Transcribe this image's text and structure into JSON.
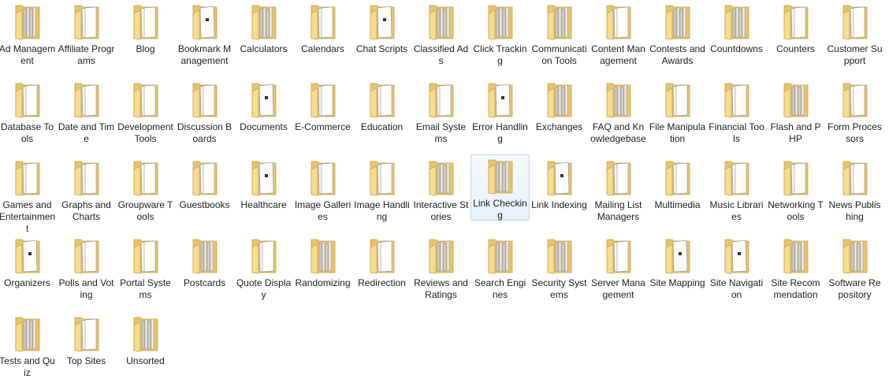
{
  "window": {
    "title": ""
  },
  "folders": [
    {
      "label": "Ad Management",
      "icon": "folder-files-icon",
      "selected": false
    },
    {
      "label": "Affiliate Programs",
      "icon": "folder-papers-icon",
      "selected": false
    },
    {
      "label": "Blog",
      "icon": "folder-papers-icon",
      "selected": false
    },
    {
      "label": "Bookmark Management",
      "icon": "folder-document-icon",
      "selected": false
    },
    {
      "label": "Calculators",
      "icon": "folder-files-icon",
      "selected": false
    },
    {
      "label": "Calendars",
      "icon": "folder-papers-icon",
      "selected": false
    },
    {
      "label": "Chat Scripts",
      "icon": "folder-document-icon",
      "selected": false
    },
    {
      "label": "Classified Ads",
      "icon": "folder-files-icon",
      "selected": false
    },
    {
      "label": "Click Tracking",
      "icon": "folder-files-icon",
      "selected": false
    },
    {
      "label": "Communication Tools",
      "icon": "folder-files-icon",
      "selected": false
    },
    {
      "label": "Content Management",
      "icon": "folder-papers-icon",
      "selected": false
    },
    {
      "label": "Contests and Awards",
      "icon": "folder-files-icon",
      "selected": false
    },
    {
      "label": "Countdowns",
      "icon": "folder-files-icon",
      "selected": false
    },
    {
      "label": "Counters",
      "icon": "folder-papers-icon",
      "selected": false
    },
    {
      "label": "Customer Support",
      "icon": "folder-papers-icon",
      "selected": false
    },
    {
      "label": "Database Tools",
      "icon": "folder-papers-icon",
      "selected": false
    },
    {
      "label": "Date and Time",
      "icon": "folder-papers-icon",
      "selected": false
    },
    {
      "label": "Development Tools",
      "icon": "folder-papers-icon",
      "selected": false
    },
    {
      "label": "Discussion Boards",
      "icon": "folder-papers-icon",
      "selected": false
    },
    {
      "label": "Documents",
      "icon": "folder-document-icon",
      "selected": false
    },
    {
      "label": "E-Commerce",
      "icon": "folder-papers-icon",
      "selected": false
    },
    {
      "label": "Education",
      "icon": "folder-papers-icon",
      "selected": false
    },
    {
      "label": "Email Systems",
      "icon": "folder-papers-icon",
      "selected": false
    },
    {
      "label": "Error Handling",
      "icon": "folder-document-icon",
      "selected": false
    },
    {
      "label": "Exchanges",
      "icon": "folder-files-icon",
      "selected": false
    },
    {
      "label": "FAQ and Knowledgebase",
      "icon": "folder-files-icon",
      "selected": false
    },
    {
      "label": "File Manipulation",
      "icon": "folder-papers-icon",
      "selected": false
    },
    {
      "label": "Financial Tools",
      "icon": "folder-papers-icon",
      "selected": false
    },
    {
      "label": "Flash and PHP",
      "icon": "folder-files-icon",
      "selected": false
    },
    {
      "label": "Form Processors",
      "icon": "folder-papers-icon",
      "selected": false
    },
    {
      "label": "Games and Entertainment",
      "icon": "folder-papers-icon",
      "selected": false
    },
    {
      "label": "Graphs and Charts",
      "icon": "folder-papers-icon",
      "selected": false
    },
    {
      "label": "Groupware Tools",
      "icon": "folder-papers-icon",
      "selected": false
    },
    {
      "label": "Guestbooks",
      "icon": "folder-papers-icon",
      "selected": false
    },
    {
      "label": "Healthcare",
      "icon": "folder-document-icon",
      "selected": false
    },
    {
      "label": "Image Galleries",
      "icon": "folder-papers-icon",
      "selected": false
    },
    {
      "label": "Image Handling",
      "icon": "folder-papers-icon",
      "selected": false
    },
    {
      "label": "Interactive Stories",
      "icon": "folder-files-icon",
      "selected": false
    },
    {
      "label": "Link Checking",
      "icon": "folder-files-icon",
      "selected": true
    },
    {
      "label": "Link Indexing",
      "icon": "folder-document-icon",
      "selected": false
    },
    {
      "label": "Mailing List Managers",
      "icon": "folder-papers-icon",
      "selected": false
    },
    {
      "label": "Multimedia",
      "icon": "folder-papers-icon",
      "selected": false
    },
    {
      "label": "Music Libraries",
      "icon": "folder-papers-icon",
      "selected": false
    },
    {
      "label": "Networking Tools",
      "icon": "folder-papers-icon",
      "selected": false
    },
    {
      "label": "News Publishing",
      "icon": "folder-papers-icon",
      "selected": false
    },
    {
      "label": "Organizers",
      "icon": "folder-document-icon",
      "selected": false
    },
    {
      "label": "Polls and Voting",
      "icon": "folder-papers-icon",
      "selected": false
    },
    {
      "label": "Portal Systems",
      "icon": "folder-papers-icon",
      "selected": false
    },
    {
      "label": "Postcards",
      "icon": "folder-files-icon",
      "selected": false
    },
    {
      "label": "Quote Display",
      "icon": "folder-papers-icon",
      "selected": false
    },
    {
      "label": "Randomizing",
      "icon": "folder-files-icon",
      "selected": false
    },
    {
      "label": "Redirection",
      "icon": "folder-papers-icon",
      "selected": false
    },
    {
      "label": "Reviews and Ratings",
      "icon": "folder-files-icon",
      "selected": false
    },
    {
      "label": "Search Engines",
      "icon": "folder-files-icon",
      "selected": false
    },
    {
      "label": "Security Systems",
      "icon": "folder-files-icon",
      "selected": false
    },
    {
      "label": "Server Management",
      "icon": "folder-papers-icon",
      "selected": false
    },
    {
      "label": "Site Mapping",
      "icon": "folder-document-icon",
      "selected": false
    },
    {
      "label": "Site Navigation",
      "icon": "folder-document-icon",
      "selected": false
    },
    {
      "label": "Site Recommendation",
      "icon": "folder-files-icon",
      "selected": false
    },
    {
      "label": "Software Repository",
      "icon": "folder-files-icon",
      "selected": false
    },
    {
      "label": "Tests and Quiz",
      "icon": "folder-files-icon",
      "selected": false
    },
    {
      "label": "Top Sites",
      "icon": "folder-papers-icon",
      "selected": false
    },
    {
      "label": "Unsorted",
      "icon": "folder-files-icon",
      "selected": false
    }
  ],
  "colors": {
    "folder_back": "#e7c46b",
    "folder_front": "#f6dc8e",
    "paper": "#fbfbfb",
    "selection_border": "#b7d7f5",
    "text": "#1e1e1e"
  }
}
